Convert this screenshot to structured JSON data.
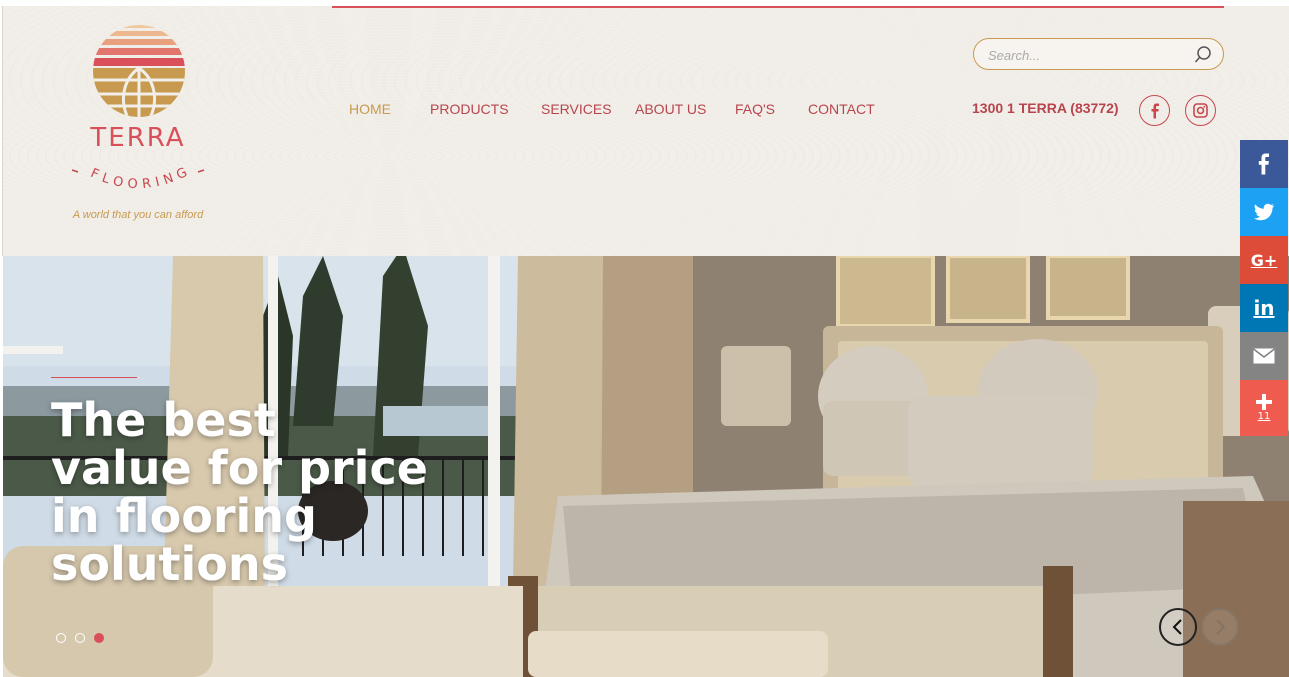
{
  "brand": {
    "name": "TERRA",
    "subname": "FLOORING",
    "tagline": "A world that you can afford",
    "colors": {
      "primary": "#d9505a",
      "gold": "#c79a50"
    }
  },
  "nav": {
    "items": [
      {
        "label": "HOME",
        "active": true
      },
      {
        "label": "PRODUCTS",
        "active": false
      },
      {
        "label": "SERVICES",
        "active": false
      },
      {
        "label": "ABOUT US",
        "active": false
      },
      {
        "label": "FAQ'S",
        "active": false
      },
      {
        "label": "CONTACT",
        "active": false
      }
    ]
  },
  "search": {
    "placeholder": "Search...",
    "value": "",
    "icon": "search-icon"
  },
  "contact": {
    "phone": "1300 1 TERRA (83772)"
  },
  "header_social": [
    {
      "name": "facebook",
      "icon": "facebook-icon"
    },
    {
      "name": "instagram",
      "icon": "instagram-icon"
    }
  ],
  "hero": {
    "headline": "The best value for price in flooring solutions",
    "slides": 3,
    "active_slide": 3,
    "prev_icon": "chevron-left-icon",
    "next_icon": "chevron-right-icon"
  },
  "share_bar": {
    "buttons": [
      {
        "name": "facebook",
        "icon": "facebook-icon",
        "color": "#3b5998"
      },
      {
        "name": "twitter",
        "icon": "twitter-icon",
        "color": "#1da1f2"
      },
      {
        "name": "google-plus",
        "icon": "google-plus-icon",
        "color": "#dd4b39"
      },
      {
        "name": "linkedin",
        "icon": "linkedin-icon",
        "color": "#0077b5"
      },
      {
        "name": "email",
        "icon": "email-icon",
        "color": "#848484"
      },
      {
        "name": "more",
        "icon": "plus-icon",
        "color": "#f05b4f",
        "count": "11"
      }
    ]
  }
}
